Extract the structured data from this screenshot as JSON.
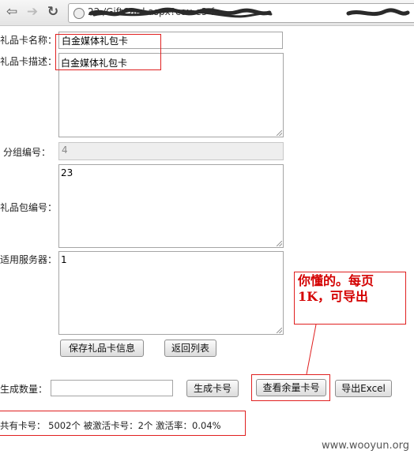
{
  "browser": {
    "back_glyph": "⇦",
    "forward_glyph": "➔",
    "reload_glyph": "↻",
    "url": "22                         /GiftCard.aspx?cou                   e3-f"
  },
  "form": {
    "name_label": "礼品卡名称：",
    "name_value": "白金媒体礼包卡",
    "desc_label": "礼品卡描述：",
    "desc_value": "白金媒体礼包卡",
    "group_label": "分组编号：",
    "group_value": "4",
    "package_label": "礼品包编号：",
    "package_value": "23",
    "server_label": "适用服务器：",
    "server_value": "1",
    "save_button": "保存礼品卡信息",
    "back_button": "返回列表"
  },
  "generate": {
    "qty_label": "生成数量：",
    "qty_value": "",
    "gen_button": "生成卡号",
    "view_button": "查看余量卡号",
    "export_button": "导出Excel"
  },
  "stats": {
    "text": "共有卡号： 5002个  被激活卡号：2个  激活率：0.04%"
  },
  "annotation": {
    "note": "你懂的。每页1K，可导出"
  },
  "watermark": "www.wooyun.org"
}
